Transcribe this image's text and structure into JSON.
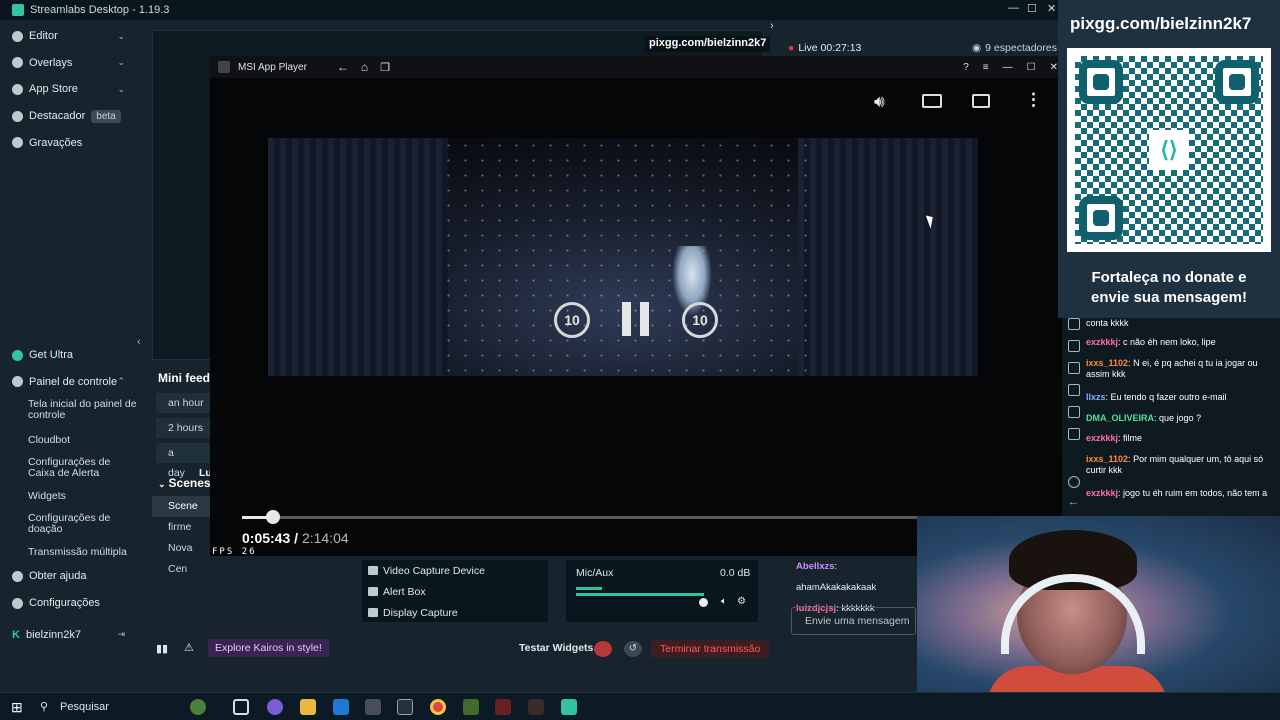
{
  "app": {
    "title": "Streamlabs Desktop - 1.19.3",
    "colors": {
      "accent": "#31c3a2",
      "live": "#e23b3b",
      "background": "#17242d"
    }
  },
  "sidebar": {
    "items": [
      {
        "label": "Editor",
        "icon": "editor-icon"
      },
      {
        "label": "Overlays",
        "icon": "overlays-icon"
      },
      {
        "label": "App Store",
        "icon": "app-store-icon"
      },
      {
        "label": "Destacador",
        "icon": "highlighter-icon",
        "badge": "beta"
      },
      {
        "label": "Gravações",
        "icon": "recordings-icon"
      }
    ],
    "bottom": [
      {
        "label": "Get Ultra",
        "icon": "ultra-icon"
      },
      {
        "label": "Painel de controle",
        "icon": "dashboard-icon"
      }
    ],
    "sub_items": [
      "Tela inicial do painel de controle",
      "Cloudbot",
      "Configurações de Caixa de Alerta",
      "Widgets",
      "Configurações de doação",
      "Transmissão múltipla"
    ],
    "footer": [
      {
        "label": "Obter ajuda",
        "icon": "help-icon"
      },
      {
        "label": "Configurações",
        "icon": "settings-icon"
      }
    ],
    "user": "bielzinn2k7"
  },
  "preview": {
    "url_banner": "pixgg.com/bielzinn2k7"
  },
  "player": {
    "title": "MSI App Player",
    "current_time": "0:05:43",
    "separator": "/",
    "duration": "2:14:04",
    "progress": 0.042,
    "fps_label": "FPS",
    "fps_value": "26",
    "skip_label": "10"
  },
  "live": {
    "status": "Live 00:27:13",
    "viewers": "9 espectadores"
  },
  "mini_feed": {
    "title": "Mini feed",
    "filters": [
      "an hour",
      "2 hours",
      "a day"
    ],
    "partial": "Lu"
  },
  "scenes": {
    "title": "Scenes",
    "items": [
      "Scene",
      "firme",
      "Nova Cen"
    ]
  },
  "sources": {
    "items": [
      "Video Capture Device",
      "Alert Box",
      "Display Capture"
    ]
  },
  "mixer": {
    "channel": "Mic/Aux",
    "level": "0.0 dB",
    "volume": 0.85
  },
  "chat_bottom": {
    "lines": [
      {
        "user": "Abellxzs",
        "text": "ahamAkakakakaak"
      },
      {
        "user": "luizdjcjsj",
        "text": "kkkkkkk"
      }
    ],
    "placeholder": "Envie uma mensagem"
  },
  "statusbar": {
    "explore": "Explore Kairos in style!",
    "test_widgets": "Testar Widgets",
    "end_stream": "Terminar transmissão"
  },
  "overlay": {
    "donation_url": "pixgg.com/bielzinn2k7",
    "message_line1": "Fortaleça no donate e",
    "message_line2": "envie sua mensagem!"
  },
  "chat_right": {
    "lines": [
      {
        "user": "",
        "text": "conta kkkk",
        "color": "#ff6fa3"
      },
      {
        "user": "exzkkkj",
        "text": "c não éh nem loko, lipe",
        "color": "#ff6fa3"
      },
      {
        "user": "ixxs_1102",
        "text": "N ei, é pq achei q tu ia jogar ou assim kkk",
        "color": "#ff8a3d"
      },
      {
        "user": "llxzs",
        "text": "Eu tendo q fazer outro e-mail",
        "color": "#7fb0ff"
      },
      {
        "user": "DMA_OLIVEIRA",
        "text": "que jogo ?",
        "color": "#4ee0a0"
      },
      {
        "user": "exzkkkj",
        "text": "filme",
        "color": "#ff6fa3"
      },
      {
        "user": "ixxs_1102",
        "text": "Por mim qualquer um, tô aqui só curtir kkk",
        "color": "#ff8a3d"
      },
      {
        "user": "exzkkkj",
        "text": "jogo tu éh ruim em todos, não tem a",
        "color": "#ff6fa3"
      }
    ]
  },
  "taskbar": {
    "search": "Pesquisar"
  }
}
